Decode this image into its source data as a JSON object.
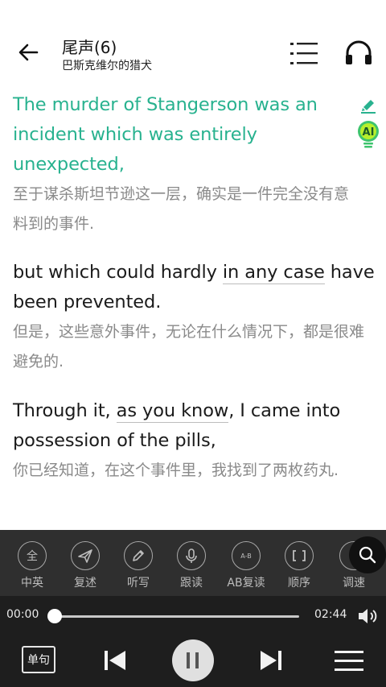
{
  "header": {
    "title": "尾声(6)",
    "subtitle": "巴斯克维尔的猎犬",
    "back_icon": "arrow-left-icon",
    "menu_icon": "chapter-list-icon",
    "audio_icon": "headphones-icon"
  },
  "paragraphs": [
    {
      "en": "The murder of Stangerson was an incident which was entirely unexpected,",
      "zh": "至于谋杀斯坦节逊这一层，确实是一件完全没有意料到的事件.",
      "active": true
    },
    {
      "en_before": "but which could hardly ",
      "en_phrase": "in any case",
      "en_after": " have been prevented.",
      "zh": "但是，这些意外事件，无论在什么情况下，都是很难避免的."
    },
    {
      "en_before": "Through it, ",
      "en_phrase": "as you know",
      "en_after": ", I came into possession of the pills,",
      "zh": "你已经知道，在这个事件里，我找到了两枚药丸."
    }
  ],
  "side_icons": {
    "edit": "highlighter-icon",
    "ai": "AI"
  },
  "tools": [
    {
      "icon": "全",
      "label": "中英"
    },
    {
      "icon": "airplane-icon",
      "label": "复述"
    },
    {
      "icon": "pencil-icon",
      "label": "听写"
    },
    {
      "icon": "microphone-icon",
      "label": "跟读"
    },
    {
      "icon": "A-B",
      "label": "AB复读"
    },
    {
      "icon": "loop-icon",
      "label": "顺序"
    },
    {
      "icon": "speed-icon",
      "label": "调速"
    }
  ],
  "player": {
    "current_time": "00:00",
    "total_time": "02:44",
    "progress": 0.0,
    "sentence_mode": "单句"
  },
  "colors": {
    "accent": "#28b28f",
    "panel_bg": "#2f2f2f",
    "player_bg": "#1e1e1e"
  }
}
